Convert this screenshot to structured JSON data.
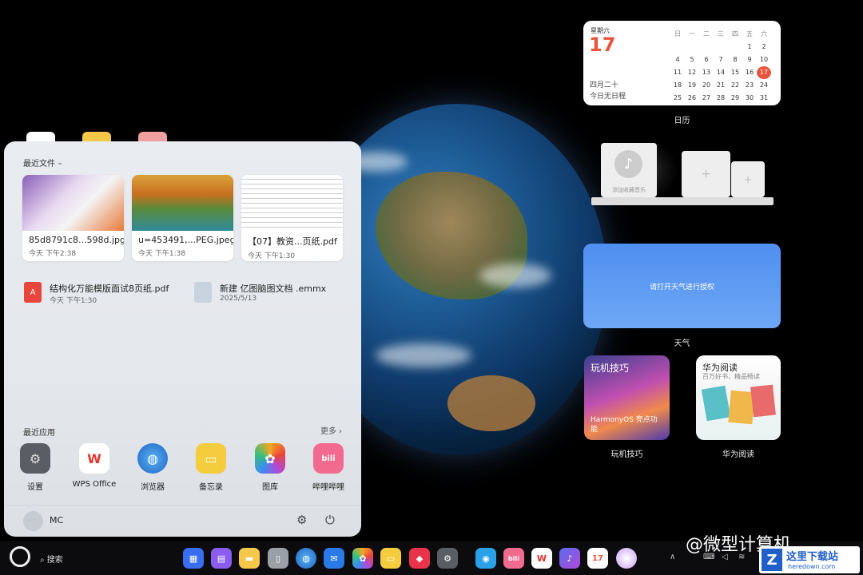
{
  "start_menu": {
    "recent_files_title": "最近文件",
    "recent_files": [
      {
        "name": "85d8791c8...598d.jpg",
        "date": "今天 下午2:38"
      },
      {
        "name": "u=453491,...PEG.jpeg",
        "date": "今天 下午1:38"
      },
      {
        "name": "【07】教资...页纸.pdf",
        "date": "今天 下午1:30"
      }
    ],
    "recent_docs": [
      {
        "name": "结构化万能模版面试8页纸.pdf",
        "date": "今天 下午1:30",
        "icon": "pdf-icon"
      },
      {
        "name": "新建 亿图脑图文档 .emmx",
        "date": "2025/5/13",
        "icon": "mindmap-icon"
      }
    ],
    "recent_apps_title": "最近应用",
    "more_label": "更多",
    "apps": [
      {
        "label": "设置",
        "icon": "settings-icon"
      },
      {
        "label": "WPS Office",
        "icon": "wps-icon"
      },
      {
        "label": "浏览器",
        "icon": "browser-icon"
      },
      {
        "label": "备忘录",
        "icon": "notes-icon"
      },
      {
        "label": "图库",
        "icon": "gallery-icon"
      },
      {
        "label": "哔哩哔哩",
        "icon": "bilibili-icon"
      }
    ],
    "user_name": "MC"
  },
  "calendar_widget": {
    "weekday": "星期六",
    "day": "17",
    "lunar": "四月二十",
    "no_schedule": "今日无日程",
    "header": [
      "日",
      "一",
      "二",
      "三",
      "四",
      "五",
      "六"
    ],
    "weeks": [
      [
        "",
        "",
        "",
        "",
        "",
        "1",
        "2"
      ],
      [
        "4",
        "5",
        "6",
        "7",
        "8",
        "9",
        "10"
      ],
      [
        "11",
        "12",
        "13",
        "14",
        "15",
        "16",
        "17"
      ],
      [
        "18",
        "19",
        "20",
        "21",
        "22",
        "23",
        "24"
      ],
      [
        "25",
        "26",
        "27",
        "28",
        "29",
        "30",
        "31"
      ]
    ],
    "label": "日历",
    "today_color": "#e8543c"
  },
  "music_widget": {
    "hint": "添加收藏音乐"
  },
  "weather_widget": {
    "message": "请打开天气进行授权",
    "label": "天气"
  },
  "tips_widget": {
    "title": "玩机技巧",
    "subtitle": "HarmonyOS 亮点功能",
    "label": "玩机技巧"
  },
  "reading_widget": {
    "title": "华为阅读",
    "subtitle": "百万好书，精品畅读",
    "label": "华为阅读"
  },
  "taskbar": {
    "search_label": "搜索",
    "watermark": "@微型计算机",
    "site_name": "这里下载站",
    "site_url": "heredown.com"
  }
}
